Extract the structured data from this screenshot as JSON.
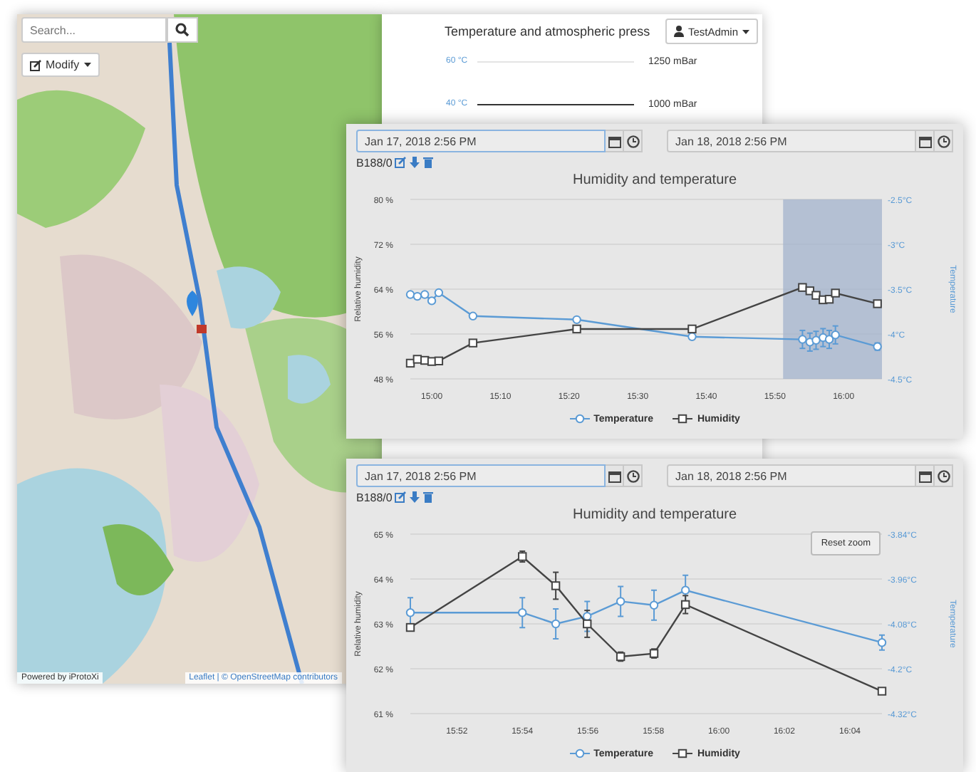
{
  "map": {
    "search": {
      "placeholder": "Search..."
    },
    "modify_button": "Modify",
    "attribution_left": "Powered by iProtoXi",
    "attribution_right": "Leaflet | © OpenStreetMap contributors"
  },
  "background_panel": {
    "user_menu": "TestAdmin",
    "title": "Temperature and atmospheric press",
    "axis_rows": [
      {
        "left": "60 °C",
        "right": "1250 mBar"
      },
      {
        "left": "40 °C",
        "right": "1000 mBar"
      }
    ]
  },
  "chart_panels": [
    {
      "start_date": "Jan 17, 2018 2:56 PM",
      "end_date": "Jan 18, 2018 2:56 PM",
      "sensor": "B188/0",
      "chart_data": {
        "type": "line",
        "title": "Humidity and temperature",
        "ylabel": "Relative humidity",
        "y2label": "Temperature",
        "x": [
          14.948,
          14.965,
          14.983,
          15,
          15.017,
          15.1,
          15.352,
          15.632,
          15.9,
          15.918,
          15.933,
          15.95,
          15.965,
          15.98,
          16.082
        ],
        "xlim": [
          14.948,
          16.093
        ],
        "grid": true,
        "ylim": [
          48,
          80
        ],
        "y2lim": [
          -4.5,
          -2.5
        ],
        "xticks": [
          {
            "value": 15,
            "label": "15:00"
          },
          {
            "value": 15.1667,
            "label": "15:10"
          },
          {
            "value": 15.3333,
            "label": "15:20"
          },
          {
            "value": 15.5,
            "label": "15:30"
          },
          {
            "value": 15.6667,
            "label": "15:40"
          },
          {
            "value": 15.8333,
            "label": "15:50"
          },
          {
            "value": 16,
            "label": "16:00"
          }
        ],
        "yticks": [
          {
            "value": 48,
            "label": "48 %"
          },
          {
            "value": 56,
            "label": "56 %"
          },
          {
            "value": 64,
            "label": "64 %"
          },
          {
            "value": 72,
            "label": "72 %"
          },
          {
            "value": 80,
            "label": "80 %"
          }
        ],
        "y2ticks": [
          {
            "value": -4.5,
            "label": "-4.5°C"
          },
          {
            "value": -4,
            "label": "-4°C"
          },
          {
            "value": -3.5,
            "label": "-3.5°C"
          },
          {
            "value": -3,
            "label": "-3°C"
          },
          {
            "value": -2.5,
            "label": "-2.5°C"
          }
        ],
        "series": [
          {
            "name": "Temperature",
            "color": "#5b9bd5",
            "marker": "circle",
            "axis": "y2",
            "values": [
              -3.56,
              -3.58,
              -3.56,
              -3.63,
              -3.54,
              -3.8,
              -3.84,
              -4.03,
              -4.06,
              -4.09,
              -4.07,
              -4.04,
              -4.06,
              -4.01,
              -4.14
            ],
            "errors": [
              null,
              null,
              null,
              null,
              null,
              null,
              null,
              null,
              0.1,
              0.1,
              0.1,
              0.1,
              0.1,
              0.1,
              0.04
            ]
          },
          {
            "name": "Humidity",
            "color": "#444444",
            "marker": "square",
            "values": [
              50.8,
              51.5,
              51.3,
              51.1,
              51.2,
              54.4,
              56.9,
              56.9,
              64.3,
              63.7,
              62.9,
              62.1,
              62.2,
              63.3,
              61.4
            ]
          }
        ],
        "bands": [
          {
            "axis": "x",
            "from": 15.853,
            "to": 16.093
          }
        ]
      }
    },
    {
      "start_date": "Jan 17, 2018 2:56 PM",
      "end_date": "Jan 18, 2018 2:56 PM",
      "sensor": "B188/0",
      "reset_zoom": "Reset zoom",
      "chart_data": {
        "type": "line",
        "title": "Humidity and temperature",
        "ylabel": "Relative humidity",
        "y2label": "Temperature",
        "x": [
          15.843,
          15.9,
          15.917,
          15.933,
          15.95,
          15.967,
          15.983,
          16.083
        ],
        "xlim": [
          15.843,
          16.083
        ],
        "grid": true,
        "ylim": [
          61,
          65
        ],
        "y2lim": [
          -4.32,
          -3.84
        ],
        "xticks": [
          {
            "value": 15.8667,
            "label": "15:52"
          },
          {
            "value": 15.9,
            "label": "15:54"
          },
          {
            "value": 15.9333,
            "label": "15:56"
          },
          {
            "value": 15.9667,
            "label": "15:58"
          },
          {
            "value": 16,
            "label": "16:00"
          },
          {
            "value": 16.0333,
            "label": "16:02"
          },
          {
            "value": 16.0667,
            "label": "16:04"
          }
        ],
        "yticks": [
          {
            "value": 61,
            "label": "61 %"
          },
          {
            "value": 62,
            "label": "62 %"
          },
          {
            "value": 63,
            "label": "63 %"
          },
          {
            "value": 64,
            "label": "64 %"
          },
          {
            "value": 65,
            "label": "65 %"
          }
        ],
        "y2ticks": [
          {
            "value": -4.32,
            "label": "-4.32°C"
          },
          {
            "value": -4.2,
            "label": "-4.2°C"
          },
          {
            "value": -4.08,
            "label": "-4.08°C"
          },
          {
            "value": -3.96,
            "label": "-3.96°C"
          },
          {
            "value": -3.84,
            "label": "-3.84°C"
          }
        ],
        "series": [
          {
            "name": "Temperature",
            "color": "#5b9bd5",
            "marker": "circle",
            "axis": "y2",
            "values": [
              -4.05,
              -4.05,
              -4.08,
              -4.06,
              -4.02,
              -4.03,
              -3.99,
              -4.13
            ],
            "errors": [
              0.04,
              0.04,
              0.04,
              0.04,
              0.04,
              0.04,
              0.04,
              0.02
            ]
          },
          {
            "name": "Humidity",
            "color": "#444444",
            "marker": "square",
            "values": [
              62.92,
              64.5,
              63.85,
              63,
              62.27,
              62.34,
              63.43,
              61.5
            ],
            "errors": [
              0.05,
              0.12,
              0.3,
              0.3,
              0.1,
              0.1,
              0.2,
              0.05
            ]
          }
        ]
      }
    }
  ]
}
